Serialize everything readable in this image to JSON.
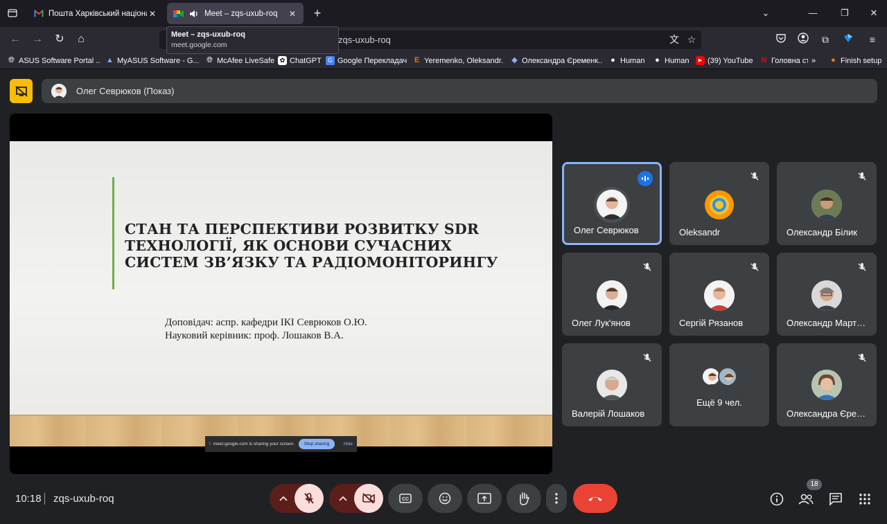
{
  "browser": {
    "tabs": [
      {
        "title": "Пошта Харківський національн",
        "icon": "gmail-icon",
        "active": false
      },
      {
        "title": "Meet – zqs-uxub-roq",
        "icon": "google-meet-icon",
        "active": true,
        "audio": true
      }
    ],
    "tooltip": {
      "title": "Meet – zqs-uxub-roq",
      "url": "meet.google.com"
    },
    "address_text": "zqs-uxub-roq",
    "bookmarks": [
      {
        "label": "ASUS Software Portal ...",
        "icon": "globe-icon"
      },
      {
        "label": "MyASUS Software - G...",
        "icon": "asus-icon"
      },
      {
        "label": "McAfee LiveSafe",
        "icon": "globe-icon"
      },
      {
        "label": "ChatGPT",
        "icon": "chatgpt-icon"
      },
      {
        "label": "Google Перекладач",
        "icon": "translate-icon"
      },
      {
        "label": "Yeremenko, Oleksandr...",
        "icon": "e-icon"
      },
      {
        "label": "Олександра Єременк...",
        "icon": "diamond-icon"
      },
      {
        "label": "Human",
        "icon": "pin-icon"
      },
      {
        "label": "Human",
        "icon": "pin-icon"
      },
      {
        "label": "(39) YouTube",
        "icon": "youtube-icon"
      },
      {
        "label": "Головна ст",
        "icon": "netflix-icon"
      },
      {
        "label": "Finish setup",
        "icon": "firefox-icon"
      }
    ]
  },
  "meet": {
    "presenter_label": "Олег Севрюков (Показ)",
    "slide": {
      "title_lines": [
        "СТАН ТА ПЕРСПЕКТИВИ РОЗВИТКУ SDR",
        "ТЕХНОЛОГІЇ, ЯК ОСНОВИ СУЧАСНИХ",
        "СИСТЕМ ЗВ’ЯЗКУ ТА РАДІОМОНІТОРИНГУ"
      ],
      "speaker": "Доповідач: аспр. кафедри ІКІ Севрюков О.Ю.",
      "advisor": "Науковий керівник: проф. Лошаков В.А.",
      "share_notice": "meet.google.com is sharing your screen.",
      "stop_sharing": "Stop sharing",
      "hide": "Hide"
    },
    "participants": [
      {
        "name": "Олег Севрюков",
        "speaking": true
      },
      {
        "name": "Oleksandr",
        "muted": true
      },
      {
        "name": "Олександр Білик",
        "muted": true
      },
      {
        "name": "Олег Лук'янов",
        "muted": true
      },
      {
        "name": "Сергій Рязанов",
        "muted": true
      },
      {
        "name": "Олександр Март…",
        "muted": true
      },
      {
        "name": "Валерій Лошаков",
        "muted": true
      },
      {
        "name": "Ещё 9 чел."
      },
      {
        "name": "Олександра Єре…",
        "muted": true
      }
    ],
    "time": "10:18",
    "meeting_code": "zqs-uxub-roq",
    "people_count": "18",
    "colors": {
      "accent": "#8ab4f8",
      "end_call": "#ea4335",
      "present": "#fbbc04"
    }
  }
}
